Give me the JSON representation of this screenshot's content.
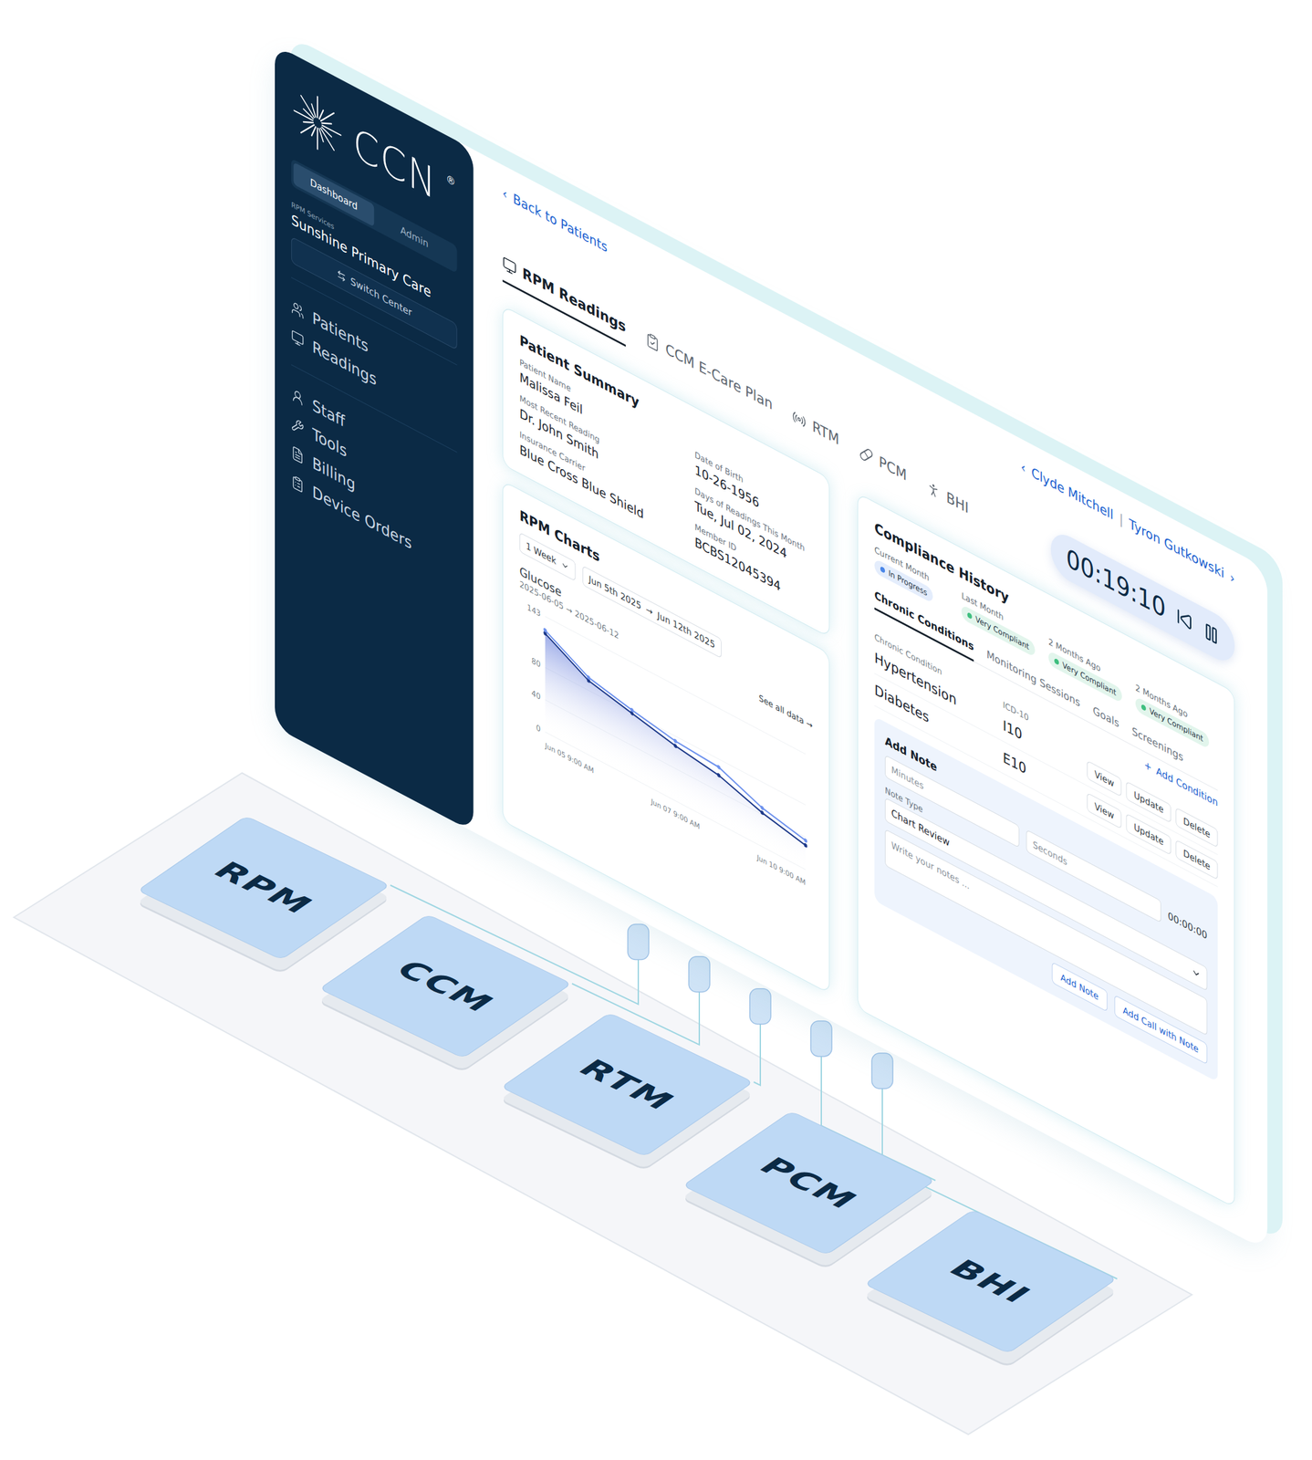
{
  "sidebar": {
    "logo": "CCN",
    "registered": "®",
    "tabs": [
      {
        "label": "Dashboard",
        "selected": true
      },
      {
        "label": "Admin",
        "selected": false
      }
    ],
    "services_label": "RPM Services",
    "center_name": "Sunshine Primary Care",
    "switch_button": "Switch Center",
    "nav_groups": [
      [
        {
          "label": "Patients"
        },
        {
          "label": "Readings"
        }
      ],
      [
        {
          "label": "Staff"
        },
        {
          "label": "Tools"
        },
        {
          "label": "Billing"
        },
        {
          "label": "Device Orders"
        }
      ]
    ]
  },
  "back_link": {
    "icon": "‹",
    "label": "Back to Patients"
  },
  "patient_switcher": {
    "prev_icon": "‹",
    "patients": [
      "Clyde Mitchell",
      "Tyron Gutkowski"
    ],
    "separator": "|",
    "next_icon": "›"
  },
  "tabs": [
    {
      "label": "RPM Readings",
      "selected": true
    },
    {
      "label": "CCM E-Care Plan",
      "selected": false
    },
    {
      "label": "RTM",
      "selected": false
    },
    {
      "label": "PCM",
      "selected": false
    },
    {
      "label": "BHI",
      "selected": false
    }
  ],
  "timer": {
    "time": "00:19:10"
  },
  "patient_summary": {
    "title": "Patient Summary",
    "columns": [
      [
        {
          "label": "Patient Name",
          "value": "Malissa Feil"
        },
        {
          "label": "Most Recent Reading",
          "value": "Dr. John Smith"
        },
        {
          "label": "Insurance Carrier",
          "value": "Blue Cross Blue Shield"
        }
      ],
      [
        {
          "label": "Date of Birth",
          "value": "10-26-1956"
        },
        {
          "label": "Days of Readings This Month",
          "value": "Tue, Jul 02, 2024"
        },
        {
          "label": "Member ID",
          "value": "BCBS12045394"
        }
      ]
    ]
  },
  "rpm_charts": {
    "title": "RPM Charts",
    "range_select": "1 Week",
    "date_from": "Jun 5th 2025",
    "date_arrow": "→",
    "date_to": "Jun 12th 2025",
    "chart": {
      "title": "Glucose",
      "subtitle": "2025-06-05 → 2025-06-12",
      "see_all": "See all data →",
      "y_ticks": [
        "143",
        "80",
        "40",
        "0"
      ],
      "x_labels": [
        "Jun 05 9:00 AM",
        "Jun 07 9:00 AM",
        "Jun 10 9:00 AM"
      ],
      "series": [
        {
          "color": "#1e3a8a",
          "values": [
            122,
            92,
            80,
            68,
            60,
            42,
            30
          ]
        },
        {
          "color": "#6f93ee",
          "values": [
            126,
            96,
            84,
            74,
            70,
            48,
            36
          ]
        }
      ]
    }
  },
  "compliance": {
    "title": "Compliance History",
    "periods": [
      {
        "label": "Current Month",
        "status": "In Progress",
        "color": "#4a86e8"
      },
      {
        "label": "Last Month",
        "status": "Very Compliant",
        "color": "#3fbf7f"
      },
      {
        "label": "2 Months Ago",
        "status": "Very Compliant",
        "color": "#3fbf7f"
      },
      {
        "label": "2 Months Ago",
        "status": "Very Compliant",
        "color": "#3fbf7f"
      }
    ]
  },
  "sub_tabs": [
    {
      "label": "Chronic Conditions",
      "selected": true
    },
    {
      "label": "Monitoring Sessions",
      "selected": false
    },
    {
      "label": "Goals",
      "selected": false
    },
    {
      "label": "Screenings",
      "selected": false
    }
  ],
  "add_condition": {
    "icon": "+",
    "label": "Add Condition"
  },
  "conditions_table": {
    "columns": [
      "Chronic Condition",
      "ICD-10"
    ],
    "rows": [
      {
        "name": "Hypertension",
        "code": "I10",
        "actions": [
          "View",
          "Update",
          "Delete"
        ]
      },
      {
        "name": "Diabetes",
        "code": "E10",
        "actions": [
          "View",
          "Update",
          "Delete"
        ]
      }
    ]
  },
  "add_note": {
    "title": "Add Note",
    "minutes_placeholder": "Minutes",
    "seconds_placeholder": "Seconds",
    "elapsed": "00:00:00",
    "note_type_label": "Note Type",
    "note_type": "Chart Review",
    "notes_placeholder": "Write your notes ...",
    "buttons": [
      "Add Note",
      "Add Call with Note"
    ]
  },
  "modules": [
    {
      "label": "RPM"
    },
    {
      "label": "CCM"
    },
    {
      "label": "RTM"
    },
    {
      "label": "PCM"
    },
    {
      "label": "BHI"
    }
  ]
}
